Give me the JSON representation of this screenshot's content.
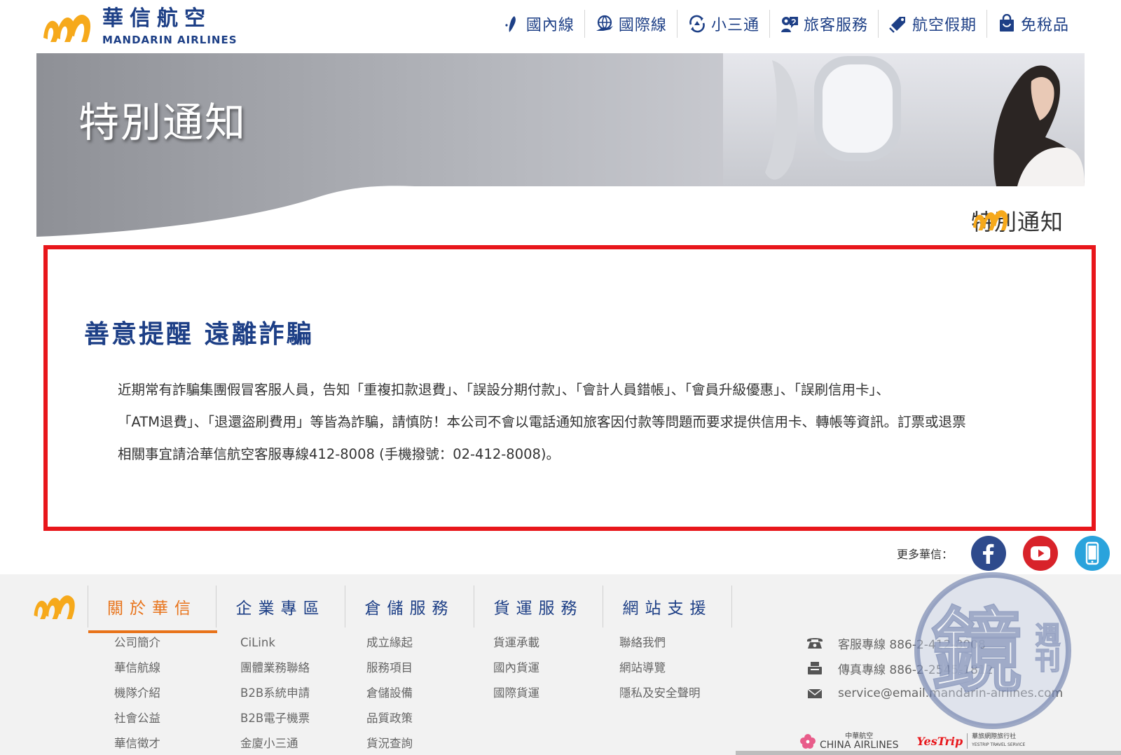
{
  "brand": {
    "name_cn": "華信航空",
    "name_en": "MANDARIN AIRLINES",
    "orange": "#F6A91B",
    "navy": "#1D3F86",
    "accent": "#E8731A",
    "alert_red": "#E8161B"
  },
  "topnav": [
    {
      "label": "國內線",
      "icon": "taiwan-map-icon"
    },
    {
      "label": "國際線",
      "icon": "globe-plane-icon"
    },
    {
      "label": "小三通",
      "icon": "route-cycle-icon"
    },
    {
      "label": "旅客服務",
      "icon": "passenger-service-icon"
    },
    {
      "label": "航空假期",
      "icon": "luggage-tag-icon"
    },
    {
      "label": "免稅品",
      "icon": "shopping-bag-icon"
    }
  ],
  "banner": {
    "title": "特別通知"
  },
  "sub_heading": "特別通知",
  "notice": {
    "title": "善意提醒 遠離詐騙",
    "lines": [
      "近期常有詐騙集團假冒客服人員，告知「重複扣款退費」、「誤設分期付款」、「會計人員錯帳」、「會員升級優惠」、「誤刷信用卡」、",
      "「ATM退費」、「退還盜刷費用」等皆為詐騙，請慎防！本公司不會以電話通知旅客因付款等問題而要求提供信用卡、轉帳等資訊。訂票或退票",
      "相關事宜請洽華信航空客服專線412-8008 (手機撥號：02-412-8008)。"
    ]
  },
  "social": {
    "label": "更多華信：",
    "items": [
      {
        "name": "facebook",
        "icon": "facebook-icon",
        "color": "#2E4A8C"
      },
      {
        "name": "youtube",
        "icon": "youtube-icon",
        "color": "#D8232A"
      },
      {
        "name": "app",
        "icon": "mobile-app-icon",
        "color": "#2AA3DC"
      }
    ]
  },
  "footer": {
    "tabs": [
      {
        "label": "關於華信",
        "active": true
      },
      {
        "label": "企業專區",
        "active": false
      },
      {
        "label": "倉儲服務",
        "active": false
      },
      {
        "label": "貨運服務",
        "active": false
      },
      {
        "label": "網站支援",
        "active": false
      }
    ],
    "columns": [
      [
        "公司簡介",
        "華信航線",
        "機隊介紹",
        "社會公益",
        "華信徵才"
      ],
      [
        "CiLink",
        "團體業務聯絡",
        "B2B系統申請",
        "B2B電子機票",
        "金廈小三通"
      ],
      [
        "成立緣起",
        "服務項目",
        "倉儲設備",
        "品質政策",
        "貨況查詢"
      ],
      [
        "貨運承載",
        "國內貨運",
        "國際貨運"
      ],
      [
        "聯絡我們",
        "網站導覽",
        "隱私及安全聲明"
      ]
    ],
    "contact": [
      {
        "icon": "phone-icon",
        "text": "客服專線 886-2-412-8008"
      },
      {
        "icon": "fax-icon",
        "text": "傳真專線 886-2-2545-1812"
      },
      {
        "icon": "mail-icon",
        "text": "service@email.mandarin-airlines.com"
      }
    ],
    "partners": {
      "china_airlines_cn": "中華航空",
      "china_airlines_en": "CHINA AIRLINES",
      "yestrip_logo": "YesTrip",
      "yestrip_cn": "華旅網際旅行社",
      "yestrip_en": "YESTRIP TRAVEL SERVICE"
    }
  },
  "watermark": {
    "icon": "mirror-media-watermark-icon",
    "glyph": "鏡",
    "side_text": "週刊"
  }
}
